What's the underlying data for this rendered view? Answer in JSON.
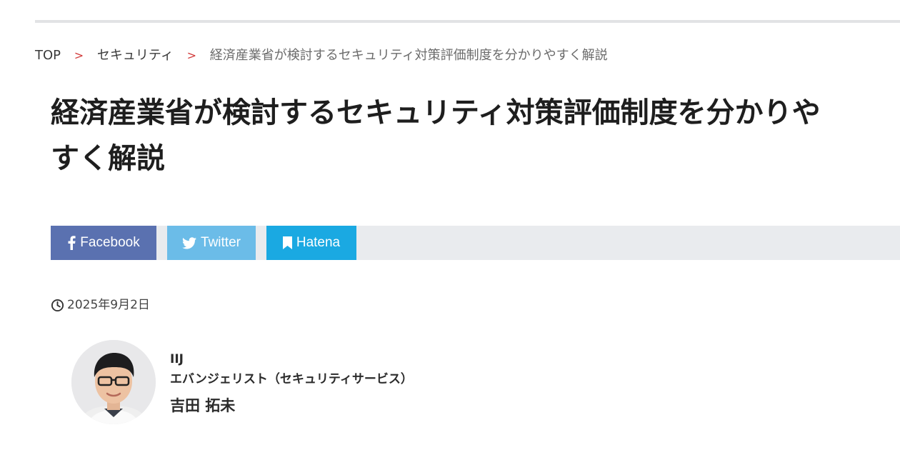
{
  "breadcrumb": {
    "top": "TOP",
    "separator": ">",
    "category": "セキュリティ",
    "current": "経済産業省が検討するセキュリティ対策評価制度を分かりやすく解説"
  },
  "article": {
    "title_line1": "経済産業省が検討するセキュリティ対策評価制度を分かりや",
    "title_line2": "すく解説",
    "date": "2025年9月2日"
  },
  "share": {
    "facebook": "Facebook",
    "twitter": "Twitter",
    "hatena": "Hatena"
  },
  "author": {
    "org": "IIJ",
    "role": "エバンジェリスト（セキュリティサービス）",
    "name": "吉田 拓未"
  },
  "colors": {
    "facebook": "#5a71b0",
    "twitter": "#6bbce8",
    "hatena": "#1aa9e2",
    "share_bar": "#e9ebee",
    "separator": "#d23b3b"
  },
  "icons": {
    "facebook": "facebook-icon",
    "twitter": "twitter-bird-icon",
    "hatena": "bookmark-icon",
    "date": "clock-icon"
  }
}
